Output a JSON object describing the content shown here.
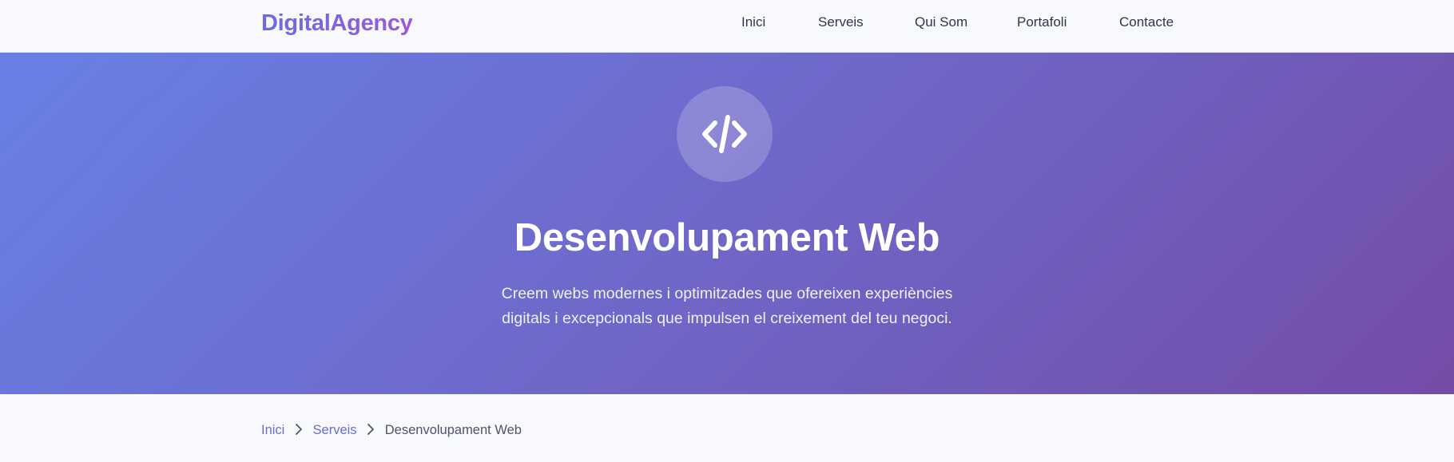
{
  "brand": {
    "logo_text": "DigitalAgency"
  },
  "nav": {
    "items": [
      {
        "label": "Inici"
      },
      {
        "label": "Serveis"
      },
      {
        "label": "Qui Som"
      },
      {
        "label": "Portafoli"
      },
      {
        "label": "Contacte"
      }
    ]
  },
  "hero": {
    "icon": "code-icon",
    "title": "Desenvolupament Web",
    "description": "Creem webs modernes i optimitzades que ofereixen experiències digitals i excepcionals que impulsen el creixement del teu negoci."
  },
  "breadcrumb": {
    "items": [
      {
        "label": "Inici"
      },
      {
        "label": "Serveis"
      }
    ],
    "current": "Desenvolupament Web",
    "separator_icon": "chevron-right-icon"
  },
  "colors": {
    "accent": "#6a6bd6",
    "hero_gradient_start": "#6880e6",
    "hero_gradient_end": "#744ca8"
  }
}
